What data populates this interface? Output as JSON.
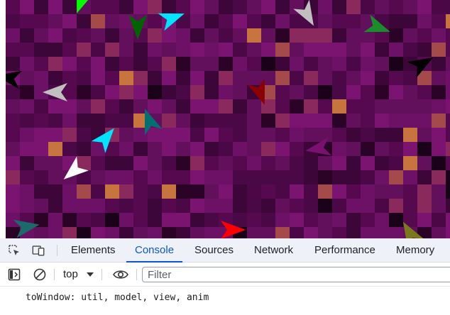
{
  "devtools": {
    "tabs": [
      {
        "label": "Elements",
        "active": false
      },
      {
        "label": "Console",
        "active": true
      },
      {
        "label": "Sources",
        "active": false
      },
      {
        "label": "Network",
        "active": false
      },
      {
        "label": "Performance",
        "active": false
      },
      {
        "label": "Memory",
        "active": false
      }
    ],
    "toolbar": {
      "context": "top",
      "filter_placeholder": "Filter"
    },
    "console": {
      "messages": [
        "toWindow: util, model, view, anim"
      ]
    },
    "icons": {
      "inspect": "inspect-element-icon",
      "device": "device-toolbar-icon",
      "sidebar": "show-sidebar-icon",
      "clear": "clear-console-icon",
      "caret": "chevron-down-icon",
      "eye": "live-expression-eye-icon"
    },
    "accent_color": "#0b57d0"
  },
  "canvas": {
    "patch_colors": [
      "#4a0846",
      "#56094f",
      "#62105c",
      "#6d1166",
      "#3d0638",
      "#7a1470",
      "#2a0327",
      "#8a2a5c",
      "#a44a4a",
      "#c8743e",
      "#1a0219"
    ],
    "agent_colors": [
      "#00ff00",
      "#006400",
      "#00e5ff",
      "#c0c0c0",
      "#1a8c2a",
      "#000000",
      "#8b0000",
      "#c8c8c8",
      "#007070",
      "#ffffff",
      "#7a1070",
      "#ff0000",
      "#1b6b6b",
      "#7a7a1a"
    ]
  }
}
